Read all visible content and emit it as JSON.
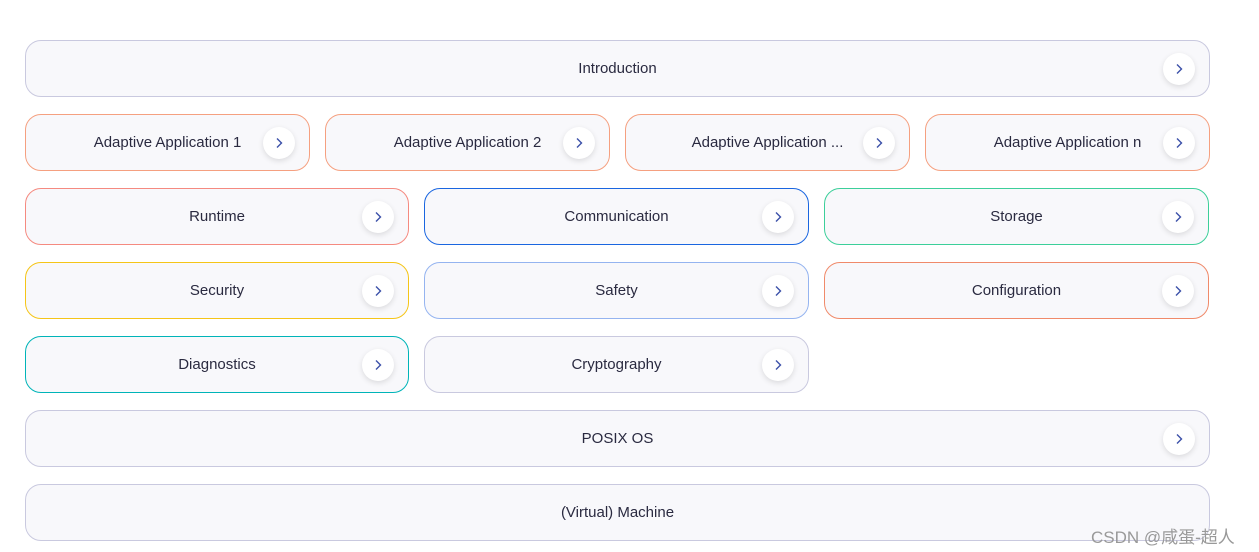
{
  "boxes": [
    {
      "label": "Introduction",
      "border": "#c9c9df",
      "arrow": true
    },
    {
      "label": "Adaptive Application 1",
      "border": "#f5a080",
      "arrow": true
    },
    {
      "label": "Adaptive Application 2",
      "border": "#f5a080",
      "arrow": true
    },
    {
      "label": "Adaptive Application ...",
      "border": "#f5a080",
      "arrow": true
    },
    {
      "label": "Adaptive Application n",
      "border": "#f5a080",
      "arrow": true
    },
    {
      "label": "Runtime",
      "border": "#f58a80",
      "arrow": true
    },
    {
      "label": "Communication",
      "border": "#1a66e0",
      "arrow": true
    },
    {
      "label": "Storage",
      "border": "#3ccf9a",
      "arrow": true
    },
    {
      "label": "Security",
      "border": "#f5c518",
      "arrow": true
    },
    {
      "label": "Safety",
      "border": "#95b4f0",
      "arrow": true
    },
    {
      "label": "Configuration",
      "border": "#f08a6a",
      "arrow": true
    },
    {
      "label": "Diagnostics",
      "border": "#00b4b8",
      "arrow": true
    },
    {
      "label": "Cryptography",
      "border": "#c9c9df",
      "arrow": true
    },
    {
      "label": "POSIX OS",
      "border": "#c9c9df",
      "arrow": true
    },
    {
      "label": "(Virtual) Machine",
      "border": "#c9c9df",
      "arrow": false
    }
  ],
  "watermark": "CSDN @咸蛋-超人",
  "arrow_icon": "chevron-right-icon",
  "arrow_color": "#3a4fa8"
}
